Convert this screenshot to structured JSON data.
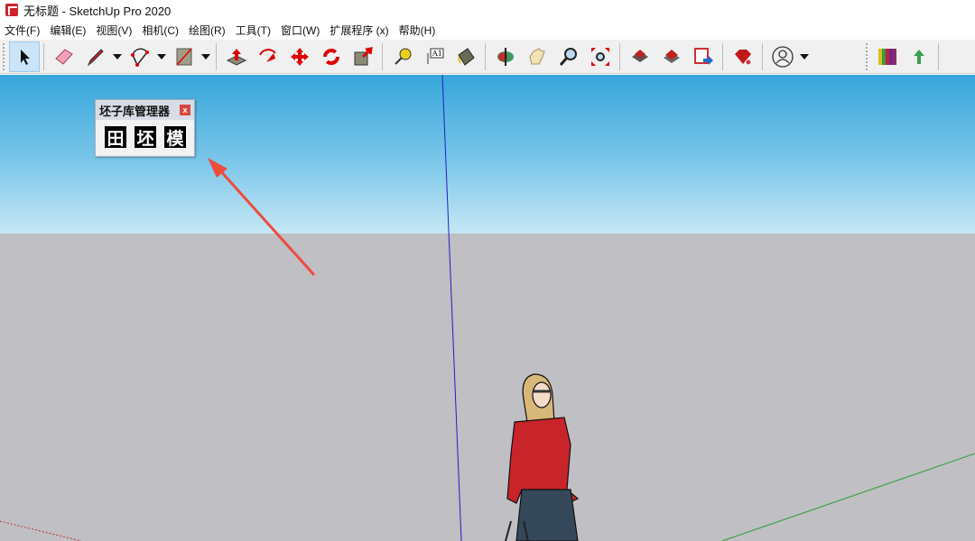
{
  "window": {
    "title": "无标题 - SketchUp Pro 2020"
  },
  "menu": [
    "文件(F)",
    "编辑(E)",
    "视图(V)",
    "相机(C)",
    "绘图(R)",
    "工具(T)",
    "窗口(W)",
    "扩展程序 (x)",
    "帮助(H)"
  ],
  "toolbar": {
    "tools": [
      "select",
      "eraser",
      "pencil",
      "arc",
      "rectangle",
      "push-pull",
      "follow-me",
      "move",
      "rotate",
      "scale",
      "tape-measure",
      "text",
      "paint-bucket",
      "orbit",
      "pan",
      "zoom",
      "zoom-extents",
      "3d-warehouse",
      "extension-warehouse",
      "layout",
      "extension-manager",
      "account",
      "styles",
      "upload"
    ]
  },
  "plugin_panel": {
    "title": "坯子库管理器",
    "close": "x",
    "buttons": [
      "田",
      "坯",
      "模"
    ]
  },
  "colors": {
    "accent": "#d0202a",
    "sky_top": "#36a6db",
    "ground": "#bfbfc4"
  }
}
